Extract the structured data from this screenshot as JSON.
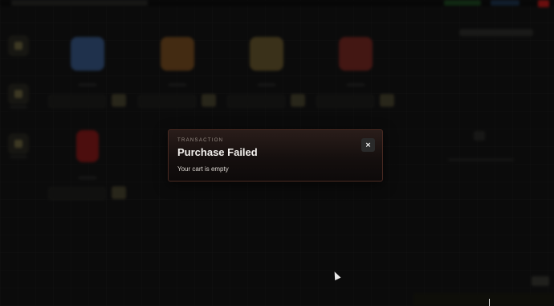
{
  "modal": {
    "kicker": "TRANSACTION",
    "title": "Purchase Failed",
    "message": "Your cart is empty",
    "close_label": "×"
  },
  "colors": {
    "background": "#151515",
    "modal_border": "#4a2a22",
    "modal_top": "#2a1d1a",
    "close_button": "#2a2a2a",
    "topbar_red": "#c21a1a"
  },
  "background_items": [
    {
      "icon": "blue-crystal-icon",
      "color": "#3a5a8a"
    },
    {
      "icon": "orange-creature-icon",
      "color": "#7a4f22"
    },
    {
      "icon": "gold-bread-icon",
      "color": "#6b5a30"
    },
    {
      "icon": "red-mushroom-icon",
      "color": "#7a2a24"
    },
    {
      "icon": "red-bag-icon",
      "color": "#8a1a1a"
    }
  ]
}
